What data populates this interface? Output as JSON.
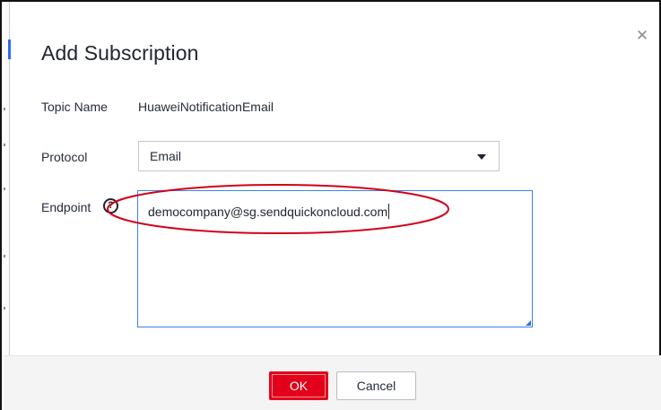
{
  "dialog": {
    "title": "Add Subscription",
    "close_icon": "close-icon"
  },
  "fields": {
    "topic_name": {
      "label": "Topic Name",
      "value": "HuaweiNotificationEmail"
    },
    "protocol": {
      "label": "Protocol",
      "selected": "Email"
    },
    "endpoint": {
      "label": "Endpoint",
      "help_icon": "?",
      "value": "democompany@sg.sendquickoncloud.com"
    }
  },
  "buttons": {
    "ok": "OK",
    "cancel": "Cancel"
  },
  "colors": {
    "primary_button": "#e2001a",
    "focus_border": "#3b82e8",
    "annotation": "#d0021b"
  }
}
